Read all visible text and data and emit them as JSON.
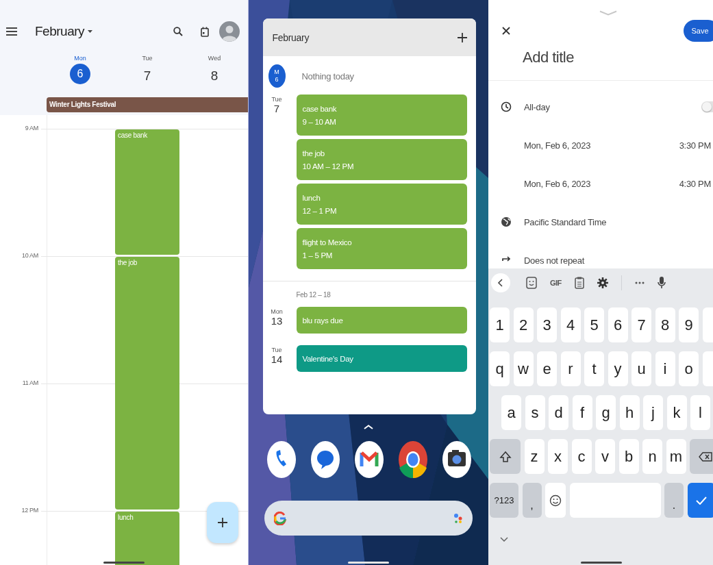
{
  "calendar": {
    "month": "February",
    "days": [
      {
        "weekday": "Mon",
        "date": "6",
        "selected": true
      },
      {
        "weekday": "Tue",
        "date": "7",
        "selected": false,
        "events": [
          {
            "title": "case bank",
            "kind": "hour"
          },
          {
            "title": "the job",
            "kind": "twohour"
          },
          {
            "title": "lunch",
            "kind": "open"
          }
        ]
      },
      {
        "weekday": "Wed",
        "date": "8",
        "selected": false
      }
    ],
    "all_day_event": "Winter Lights Festival",
    "hours": [
      "9 AM",
      "10 AM",
      "11 AM",
      "12 PM"
    ]
  },
  "widget": {
    "title": "February",
    "today": {
      "weekday": "M",
      "date": "6",
      "note": "Nothing today"
    },
    "sections": [
      {
        "days": [
          {
            "weekday": "Tue",
            "date": "7",
            "events": [
              {
                "title": "case bank",
                "time": "9 – 10 AM",
                "color": "#7cb342"
              },
              {
                "title": "the job",
                "time": "10 AM – 12 PM",
                "color": "#7cb342"
              },
              {
                "title": "lunch",
                "time": "12 – 1 PM",
                "color": "#7cb342"
              },
              {
                "title": "flight to Mexico",
                "time": "1 – 5 PM",
                "color": "#7cb342"
              }
            ]
          }
        ]
      },
      {
        "range": "Feb 12 – 18",
        "days": [
          {
            "weekday": "Mon",
            "date": "13",
            "events": [
              {
                "title": "blu rays due",
                "color": "#7cb342"
              }
            ]
          },
          {
            "weekday": "Tue",
            "date": "14",
            "events": [
              {
                "title": "Valentine's Day",
                "color": "#0e9a86"
              }
            ]
          }
        ]
      }
    ]
  },
  "dock": {
    "apps": [
      {
        "kind": "phone"
      },
      {
        "kind": "chat"
      },
      {
        "kind": "mail"
      },
      {
        "kind": "browser"
      },
      {
        "kind": "camera"
      }
    ]
  },
  "editor": {
    "save": "Save",
    "title_placeholder": "Add title",
    "rows": [
      {
        "kind": "allday",
        "label": "All-day",
        "on": false
      },
      {
        "kind": "datetime",
        "date": "Mon, Feb 6, 2023",
        "time": "3:30 PM"
      },
      {
        "kind": "datetime",
        "date": "Mon, Feb 6, 2023",
        "time": "4:30 PM"
      },
      {
        "kind": "timezone",
        "label": "Pacific Standard Time"
      },
      {
        "kind": "repeat",
        "label": "Does not repeat"
      }
    ]
  },
  "keyboard": {
    "toolbar": [
      {
        "kind": "back"
      },
      {
        "kind": "sticker"
      },
      {
        "kind": "gif",
        "label": "GIF"
      },
      {
        "kind": "clipboard"
      },
      {
        "kind": "settings"
      },
      {
        "kind": "divider"
      },
      {
        "kind": "more"
      },
      {
        "kind": "mic"
      }
    ],
    "rows": [
      [
        {
          "kind": "char",
          "label": "1"
        },
        {
          "kind": "char",
          "label": "2"
        },
        {
          "kind": "char",
          "label": "3"
        },
        {
          "kind": "char",
          "label": "4"
        },
        {
          "kind": "char",
          "label": "5"
        },
        {
          "kind": "char",
          "label": "6"
        },
        {
          "kind": "char",
          "label": "7"
        },
        {
          "kind": "char",
          "label": "8"
        },
        {
          "kind": "char",
          "label": "9"
        },
        {
          "kind": "cut"
        }
      ],
      [
        {
          "kind": "char",
          "label": "q"
        },
        {
          "kind": "char",
          "label": "w"
        },
        {
          "kind": "char",
          "label": "e"
        },
        {
          "kind": "char",
          "label": "r"
        },
        {
          "kind": "char",
          "label": "t"
        },
        {
          "kind": "char",
          "label": "y"
        },
        {
          "kind": "char",
          "label": "u"
        },
        {
          "kind": "char",
          "label": "i"
        },
        {
          "kind": "char",
          "label": "o"
        },
        {
          "kind": "cut"
        }
      ],
      [
        {
          "kind": "char",
          "label": "a"
        },
        {
          "kind": "char",
          "label": "s"
        },
        {
          "kind": "char",
          "label": "d"
        },
        {
          "kind": "char",
          "label": "f"
        },
        {
          "kind": "char",
          "label": "g"
        },
        {
          "kind": "char",
          "label": "h"
        },
        {
          "kind": "char",
          "label": "j"
        },
        {
          "kind": "char",
          "label": "k"
        },
        {
          "kind": "char",
          "label": "l"
        }
      ],
      [
        {
          "kind": "shift"
        },
        {
          "kind": "char",
          "label": "z"
        },
        {
          "kind": "char",
          "label": "x"
        },
        {
          "kind": "char",
          "label": "c"
        },
        {
          "kind": "char",
          "label": "v"
        },
        {
          "kind": "char",
          "label": "b"
        },
        {
          "kind": "char",
          "label": "n"
        },
        {
          "kind": "char",
          "label": "m"
        },
        {
          "kind": "backspace"
        }
      ],
      [
        {
          "kind": "symbols",
          "label": "?123"
        },
        {
          "kind": "comma",
          "label": ","
        },
        {
          "kind": "emoji"
        },
        {
          "kind": "space"
        },
        {
          "kind": "period",
          "label": "."
        },
        {
          "kind": "enter"
        }
      ]
    ]
  }
}
